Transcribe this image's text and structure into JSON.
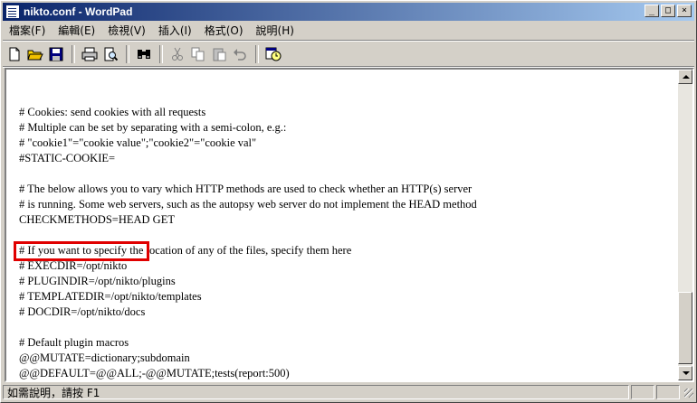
{
  "window": {
    "title": "nikto.conf - WordPad"
  },
  "window_controls": {
    "minimize": "_",
    "maximize": "□",
    "close": "×"
  },
  "menu": [
    "檔案(F)",
    "編輯(E)",
    "檢視(V)",
    "插入(I)",
    "格式(O)",
    "說明(H)"
  ],
  "toolbar": {
    "buttons": [
      "new-document",
      "open-folder",
      "save",
      "print",
      "print-preview",
      "find",
      "cut",
      "copy",
      "paste",
      "undo",
      "insert-date-time"
    ]
  },
  "document": {
    "lines": [
      "",
      "# Cookies: send cookies with all requests",
      "# Multiple can be set by separating with a semi-colon, e.g.:",
      "# \"cookie1\"=\"cookie value\";\"cookie2\"=\"cookie val\"",
      "#STATIC-COOKIE=",
      "",
      "# The below allows you to vary which HTTP methods are used to check whether an HTTP(s) server",
      "# is running. Some web servers, such as the autopsy web server do not implement the HEAD method",
      "CHECKMETHODS=HEAD GET",
      "",
      "# If you want to specify the location of any of the files, specify them here",
      "# EXECDIR=/opt/nikto",
      "# PLUGINDIR=/opt/nikto/plugins",
      "# TEMPLATEDIR=/opt/nikto/templates",
      "# DOCDIR=/opt/nikto/docs",
      "",
      "# Default plugin macros",
      "@@MUTATE=dictionary;subdomain",
      "@@DEFAULT=@@ALL;-@@MUTATE;tests(report:500)"
    ],
    "highlight_color": "#e00000"
  },
  "statusbar": {
    "text": "如需說明，請按 F1"
  },
  "colors": {
    "titlebar_start": "#0a246a",
    "titlebar_end": "#a6caf0",
    "chrome": "#d4d0c8"
  }
}
